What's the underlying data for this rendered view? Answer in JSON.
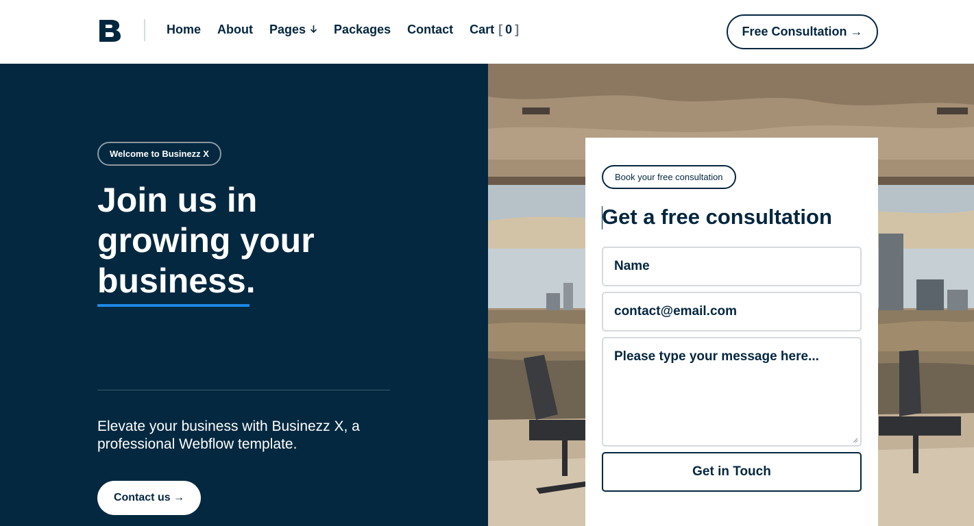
{
  "brand": {
    "logo_letter": "B"
  },
  "nav": {
    "items": [
      {
        "label": "Home"
      },
      {
        "label": "About"
      },
      {
        "label": "Pages"
      },
      {
        "label": "Packages"
      },
      {
        "label": "Contact"
      },
      {
        "label": "Cart"
      }
    ],
    "cart_open": "[",
    "cart_count": "0",
    "cart_close": "]",
    "cta": "Free Consultation →"
  },
  "hero": {
    "badge": "Welcome to Businezz X",
    "title_line1": "Join us in",
    "title_line2": "growing your",
    "title_line3": "business.",
    "subtitle": "Elevate your business with Businezz X, a professional Webflow template.",
    "button": "Contact us →",
    "accent_color": "#1e88e5",
    "background_color": "#03283f"
  },
  "form": {
    "badge": "Book your free consultation",
    "title": "Get a free consultation",
    "name_placeholder": "Name",
    "email_placeholder": "contact@email.com",
    "message_placeholder": "Please type your message here...",
    "submit": "Get in Touch"
  },
  "icons": {
    "pages_dropdown": "arrow-down-icon",
    "textarea_resize": "resize-handle-icon"
  }
}
